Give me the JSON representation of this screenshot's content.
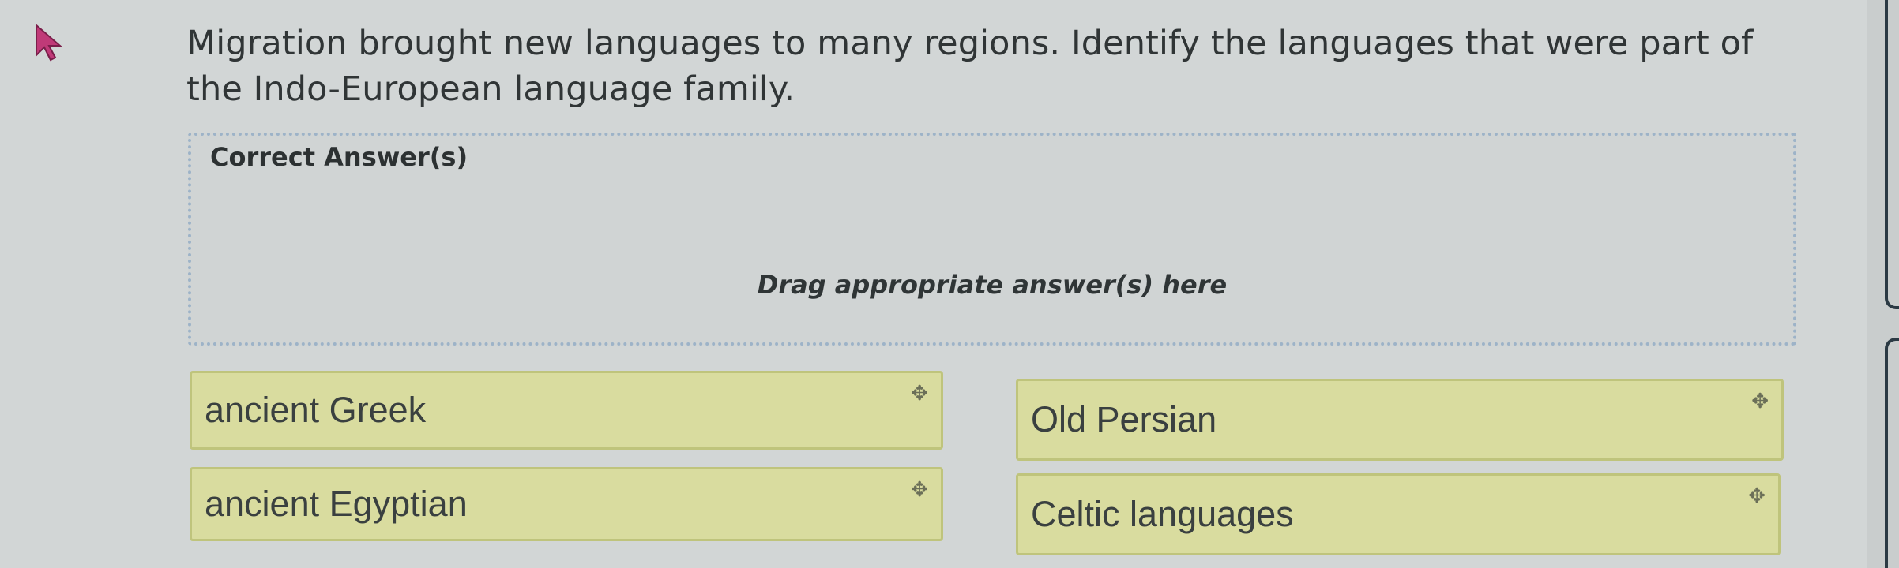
{
  "question": {
    "text": "Migration brought new languages to many regions. Identify the languages that were part of the Indo-European language family."
  },
  "dropzone": {
    "heading": "Correct Answer(s)",
    "hint": "Drag appropriate answer(s) here"
  },
  "options": [
    {
      "label": "ancient Greek",
      "icon": "move-icon"
    },
    {
      "label": "Old Persian",
      "icon": "move-icon"
    },
    {
      "label": "ancient Egyptian",
      "icon": "move-icon"
    },
    {
      "label": "Celtic languages",
      "icon": "move-icon"
    }
  ],
  "colors": {
    "background": "#d2d6d6",
    "tile_fill": "#d9dc9f",
    "tile_border": "#bfc47c",
    "dropzone_border": "#9db3c8",
    "cursor": "#c03a78"
  }
}
